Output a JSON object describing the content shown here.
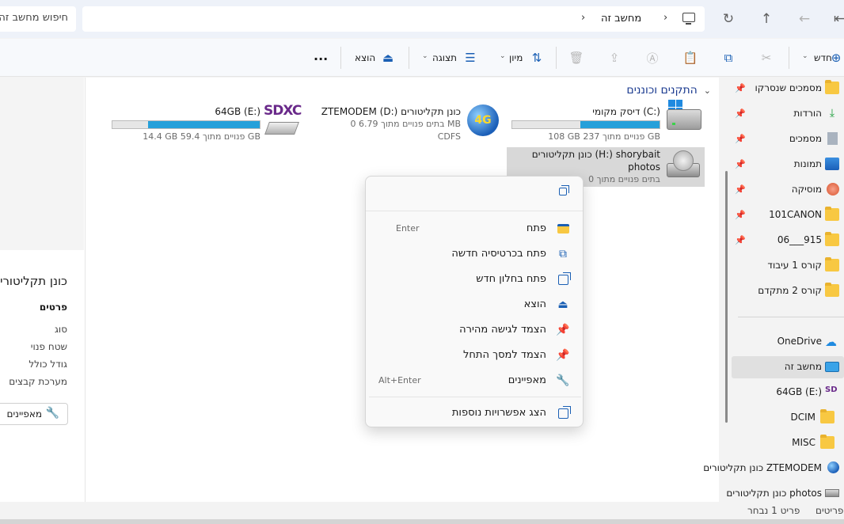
{
  "address": {
    "breadcrumb": "מחשב זה",
    "search_placeholder": "חיפוש מחשב זה"
  },
  "toolbar": {
    "new_label": "חדש",
    "sort_label": "מיון",
    "view_label": "תצוגה",
    "eject_label": "הוצא",
    "more_label": "..."
  },
  "sidebar": {
    "items": [
      {
        "label": "מסמכים שנסרקו",
        "icon": "folder-icon",
        "pinned": true
      },
      {
        "label": "הורדות",
        "icon": "download-icon",
        "pinned": true
      },
      {
        "label": "מסמכים",
        "icon": "document-icon",
        "pinned": true
      },
      {
        "label": "תמונות",
        "icon": "pictures-icon",
        "pinned": true
      },
      {
        "label": "מוסיקה",
        "icon": "music-icon",
        "pinned": true
      },
      {
        "label": "101CANON",
        "icon": "folder-icon",
        "pinned": true
      },
      {
        "label": "06___915",
        "icon": "folder-icon",
        "pinned": true
      },
      {
        "label": "קורס 1 עיבוד",
        "icon": "folder-icon",
        "pinned": false
      },
      {
        "label": "קורס 2 מתקדם",
        "icon": "folder-icon",
        "pinned": false
      }
    ],
    "onedrive": "OneDrive",
    "this_pc": "מחשב זה",
    "drive_e": "64GB (E:)",
    "dcim": "DCIM",
    "misc": "MISC",
    "ztemodem": "כונן תקליטורים ZTEMODEM",
    "photos": "כונן תקליטורים photos"
  },
  "main": {
    "section_title": "התקנים וכוננים",
    "drives": [
      {
        "name": "דיסק מקומי (C:)",
        "free_text": "108 GB פנויים מתוך 237 GB",
        "used_fraction": 0.54,
        "icon": "hdd-windows-icon"
      },
      {
        "name": "ZTEMODEM (D:) כונן תקליטורים",
        "line2": "0 בתים פנויים מתוך 6.79 MB",
        "line3": "CDFS",
        "icon": "4g-modem-icon"
      },
      {
        "name": "64GB (E:)",
        "free_text": "14.4 GB פנויים מתוך 59.4 GB",
        "used_fraction": 0.76,
        "icon": "sdxc-icon"
      },
      {
        "name": "כונן תקליטורים (H:) shorybait",
        "line2": "photos",
        "line3": "0 בתים פנויים מתוך",
        "icon": "cd-drive-icon"
      }
    ]
  },
  "details": {
    "title": "כונן תקליטורים",
    "section": "פרטים",
    "keys": [
      "סוג",
      "שטח פנוי",
      "גודל כולל",
      "מערכת קבצים"
    ],
    "properties_button": "מאפיינים"
  },
  "context_menu": {
    "items": [
      {
        "label": "פתח",
        "shortcut": "Enter",
        "icon": "folder-open-icon"
      },
      {
        "label": "פתח בכרטיסיה חדשה",
        "shortcut": "",
        "icon": "new-tab-icon"
      },
      {
        "label": "פתח בחלון חדש",
        "shortcut": "",
        "icon": "new-window-icon"
      },
      {
        "label": "הוצא",
        "shortcut": "",
        "icon": "eject-icon"
      },
      {
        "label": "הצמד לגישה מהירה",
        "shortcut": "",
        "icon": "pin-icon"
      },
      {
        "label": "הצמד למסך התחל",
        "shortcut": "",
        "icon": "pin-icon"
      },
      {
        "label": "מאפיינים",
        "shortcut": "Alt+Enter",
        "icon": "wrench-icon"
      }
    ],
    "more_options": "הצג אפשרויות נוספות"
  },
  "status": {
    "items_text": "פריטים",
    "selected_text": "פריט 1 נבחר"
  },
  "colors": {
    "accent": "#1a5fb4",
    "drive_bar": "#26a0da",
    "folder": "#f8c842"
  }
}
